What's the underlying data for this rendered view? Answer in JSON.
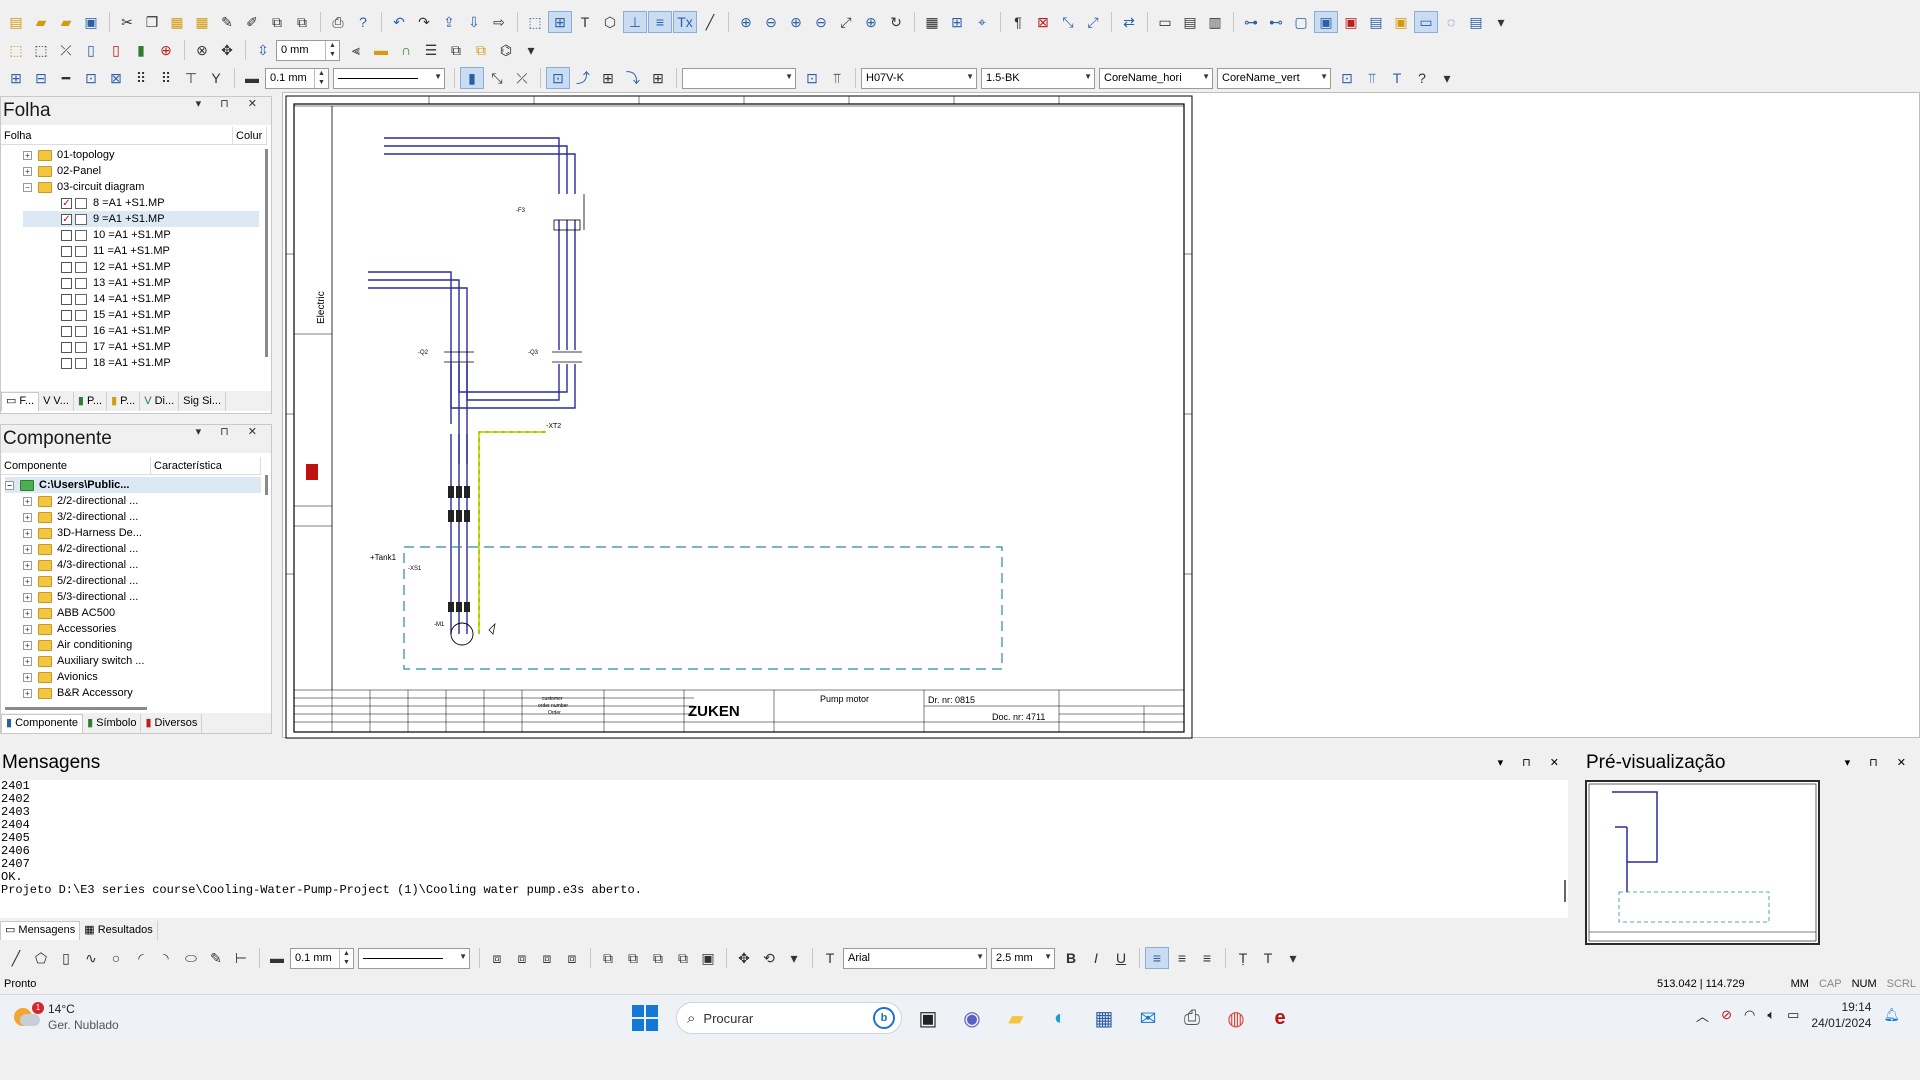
{
  "toolbar": {
    "dist_value": "0 mm",
    "line_width": "0.1 mm",
    "wire_type": "H07V-K",
    "wire_color": "1.5-BK",
    "core_name_h": "CoreName_hori",
    "core_name_v": "CoreName_vert",
    "empty_combo": ""
  },
  "folha_panel": {
    "title": "Folha",
    "col_name": "Folha",
    "col_color": "Colur",
    "folders": [
      "01-topology",
      "02-Panel",
      "03-circuit diagram"
    ],
    "sheets": [
      "8 =A1 +S1.MP",
      "9 =A1 +S1.MP",
      "10 =A1 +S1.MP",
      "11 =A1 +S1.MP",
      "12 =A1 +S1.MP",
      "13 =A1 +S1.MP",
      "14 =A1 +S1.MP",
      "15 =A1 +S1.MP",
      "16 =A1 +S1.MP",
      "17 =A1 +S1.MP",
      "18 =A1 +S1.MP"
    ],
    "tabs": [
      "F...",
      "V...",
      "P...",
      "P...",
      "Di...",
      "Sig Si..."
    ]
  },
  "componente_panel": {
    "title": "Componente",
    "col_name": "Componente",
    "col_char": "Característica",
    "root": "C:\\Users\\Public...",
    "items": [
      "2/2-directional ...",
      "3/2-directional ...",
      "3D-Harness De...",
      "4/2-directional ...",
      "4/3-directional ...",
      "5/2-directional ...",
      "5/3-directional ...",
      "ABB AC500",
      "Accessories",
      "Air conditioning",
      "Auxiliary switch ...",
      "Avionics",
      "B&R Accessory"
    ],
    "tabs": [
      "Componente",
      "Símbolo",
      "Diversos"
    ]
  },
  "drawing": {
    "tank_label": "+Tank1",
    "side_label": "Electric",
    "motor_label": "-M1",
    "title_block": {
      "logo": "ZUKEN",
      "description": "Pump motor",
      "drawing_nr": "Dr. nr: 0815",
      "doc_nr": "Doc. nr: 4711",
      "customer": "customer",
      "order_number": "order number",
      "order": "Order"
    },
    "labels": {
      "xt2": "-XT2",
      "f3": "-F3",
      "q2": "-Q2",
      "q3": "-Q3",
      "xs1": "-XS1"
    }
  },
  "messages": {
    "title": "Mensagens",
    "lines": [
      "2401",
      "2402",
      "2403",
      "2404",
      "2405",
      "2406",
      "2407",
      "OK.",
      "Projeto D:\\E3 series course\\Cooling-Water-Pump-Project (1)\\Cooling water pump.e3s aberto."
    ],
    "tabs": [
      "Mensagens",
      "Resultados"
    ]
  },
  "preview": {
    "title": "Pré-visualização"
  },
  "bottom_toolbar": {
    "line_width": "0.1 mm",
    "font": "Arial",
    "font_size": "2.5 mm"
  },
  "status": {
    "left": "Pronto",
    "coords": "513.042 | 114.729",
    "unit": "MM",
    "caps": "CAP",
    "num": "NUM",
    "scrl": "SCRL"
  },
  "taskbar": {
    "temp": "14°C",
    "weather": "Ger. Nublado",
    "weather_badge": "1",
    "search": "Procurar",
    "time": "19:14",
    "date": "24/01/2024"
  },
  "colors": {
    "wire_blue": "#2b2b9a",
    "pe_green": "#9acd32",
    "pe_yellow": "#e8d800",
    "tank_dash": "#2a8aa0"
  }
}
